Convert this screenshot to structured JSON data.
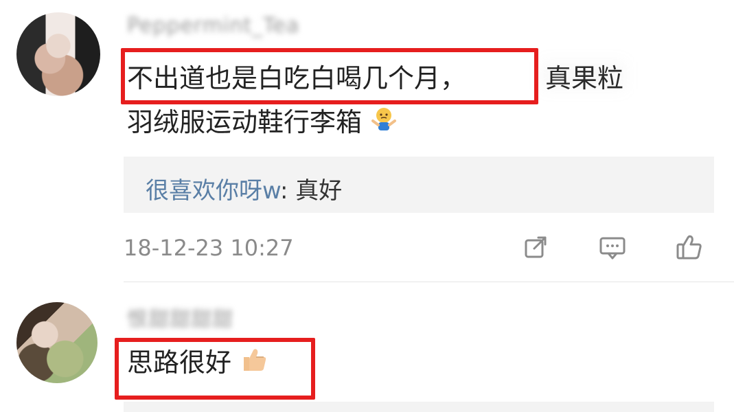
{
  "comments": [
    {
      "username": "Peppermint_Tea",
      "content_highlight": "不出道也是白吃白喝几个月，",
      "content_tail": "真果粒",
      "content_line2": "羽绒服运动鞋行李箱",
      "emoji": "shrug-emoji",
      "reply": {
        "name": "很喜欢你呀w",
        "text": ": 真好"
      },
      "timestamp": "18-12-23 10:27",
      "actions": [
        "share-icon",
        "comment-icon",
        "like-icon"
      ]
    },
    {
      "username": "恨甜甜甜甜",
      "content": "思路很好",
      "emoji": "thumbs-up-emoji"
    }
  ],
  "colors": {
    "highlight_border": "#e61e1e",
    "reply_name": "#5a7fa6",
    "meta_text": "#8a8a8a"
  }
}
